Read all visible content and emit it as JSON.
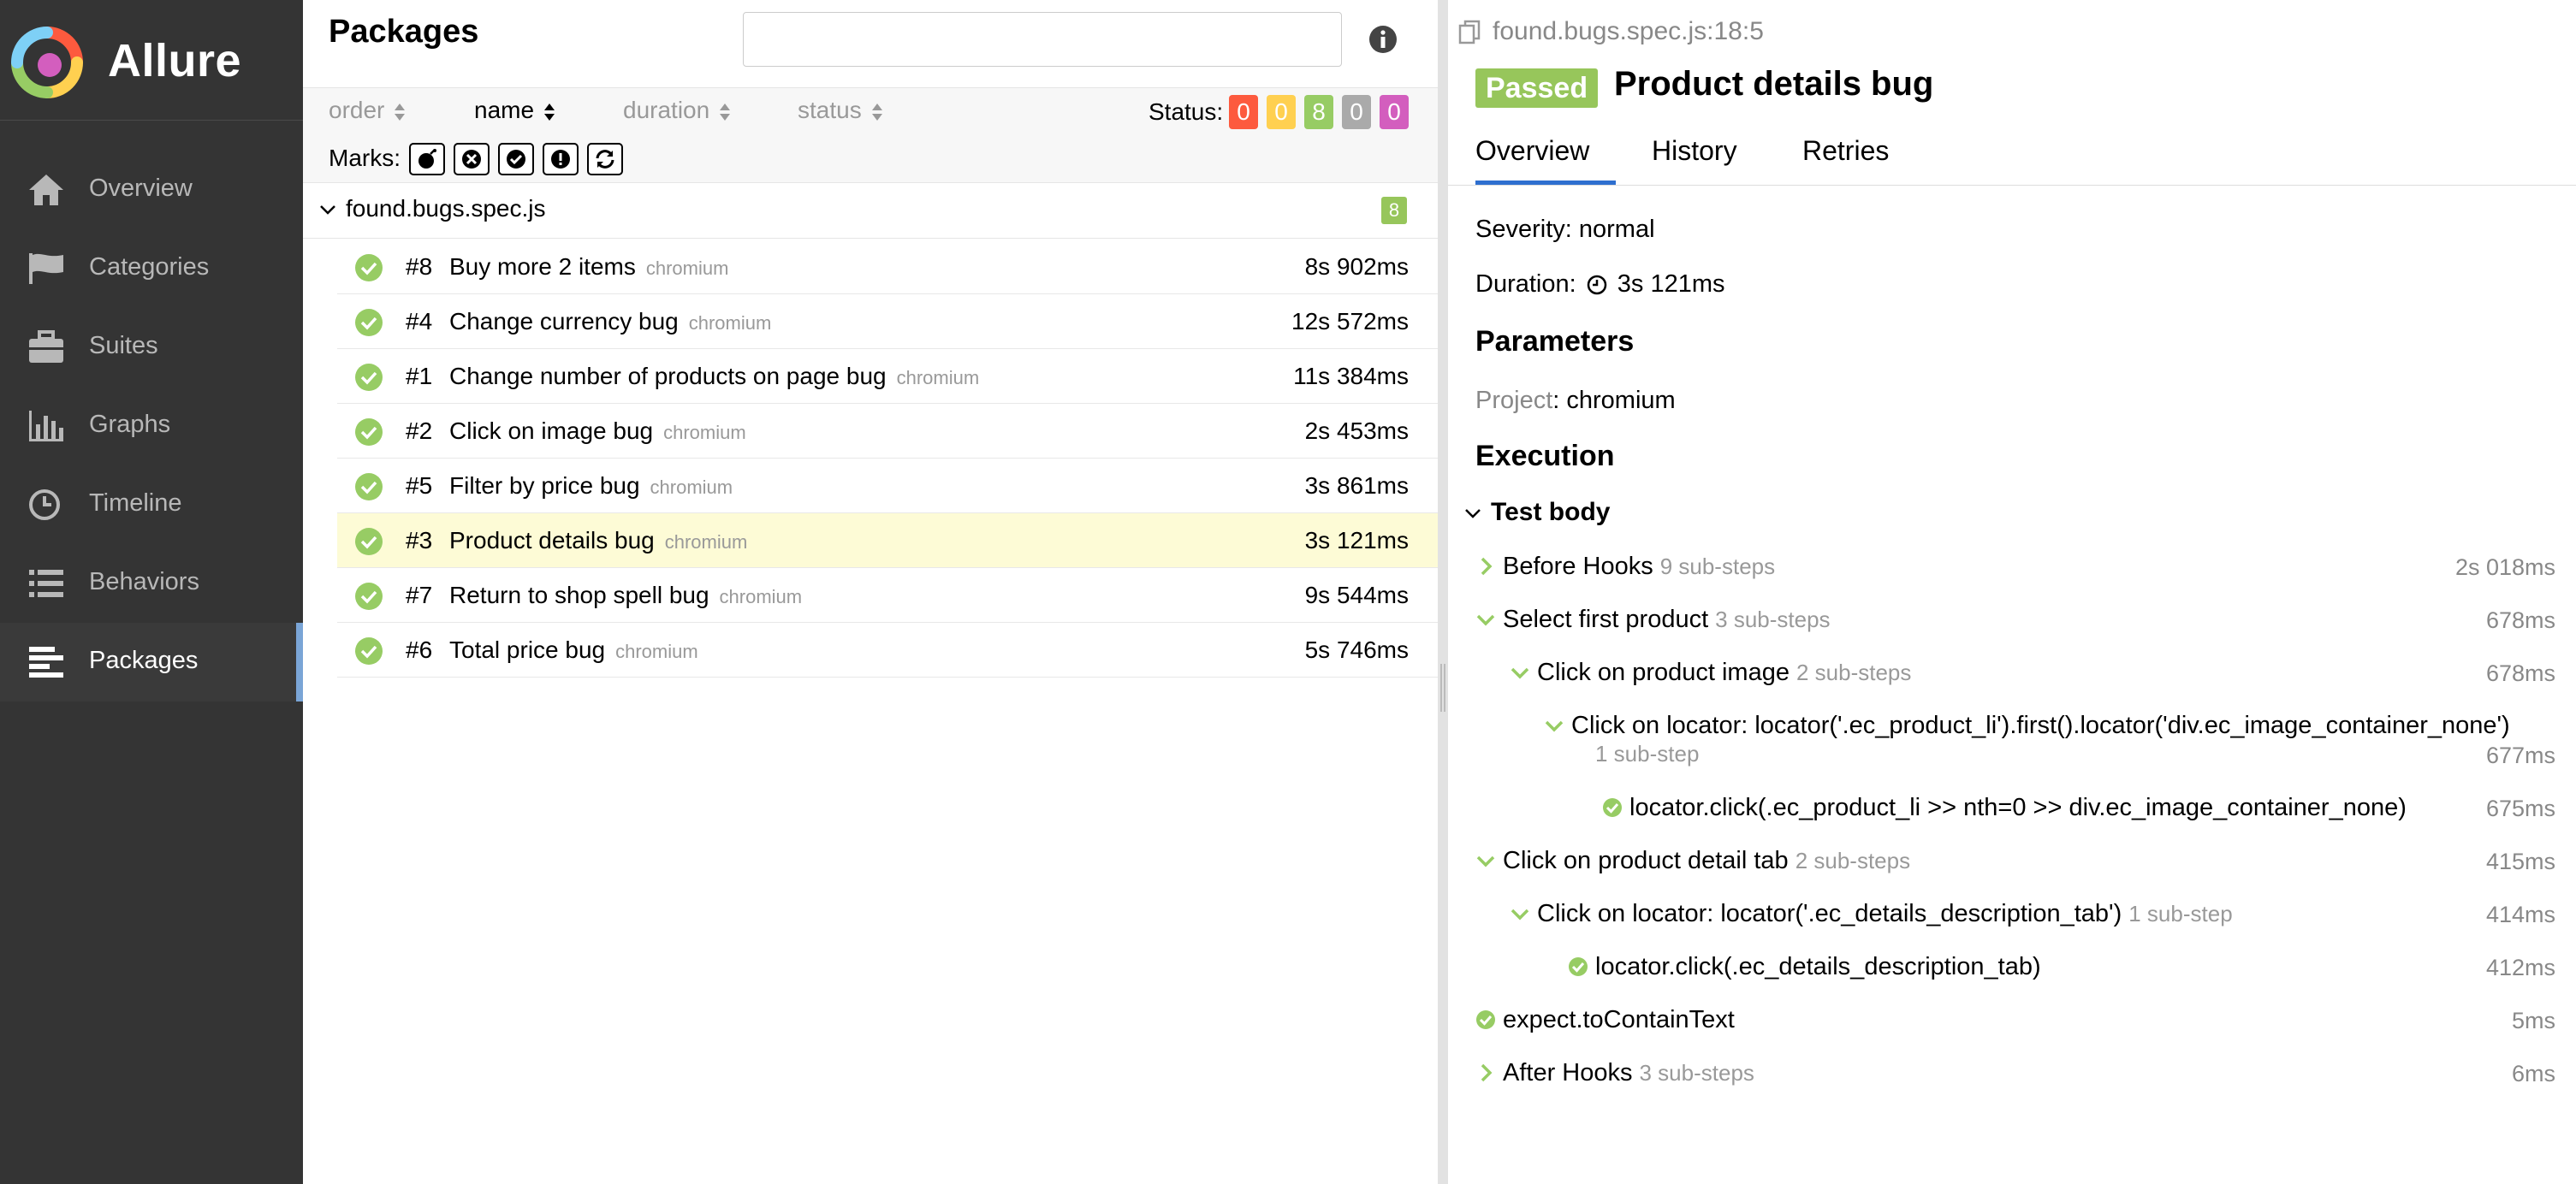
{
  "app": {
    "name": "Allure"
  },
  "sidebar": {
    "items": [
      {
        "label": "Overview",
        "icon": "home-icon"
      },
      {
        "label": "Categories",
        "icon": "flag-icon"
      },
      {
        "label": "Suites",
        "icon": "briefcase-icon"
      },
      {
        "label": "Graphs",
        "icon": "bar-chart-icon"
      },
      {
        "label": "Timeline",
        "icon": "clock-icon"
      },
      {
        "label": "Behaviors",
        "icon": "list-icon"
      },
      {
        "label": "Packages",
        "icon": "align-left-icon",
        "active": true
      }
    ]
  },
  "packages": {
    "title": "Packages",
    "filter_value": "",
    "sort": [
      {
        "label": "order"
      },
      {
        "label": "name",
        "active": true
      },
      {
        "label": "duration"
      },
      {
        "label": "status"
      }
    ],
    "status_label": "Status:",
    "status_counts": [
      {
        "value": "0",
        "color": "#fd5a3e",
        "status": "failed"
      },
      {
        "value": "0",
        "color": "#ffd050",
        "status": "broken"
      },
      {
        "value": "8",
        "color": "#97cc64",
        "status": "passed"
      },
      {
        "value": "0",
        "color": "#aaaaaa",
        "status": "skipped"
      },
      {
        "value": "0",
        "color": "#d35ebe",
        "status": "unknown"
      }
    ],
    "marks_label": "Marks:",
    "marks": [
      "flaky-icon",
      "new-failed-icon",
      "new-passed-icon",
      "new-broken-icon",
      "retries-icon"
    ],
    "group": {
      "name": "found.bugs.spec.js",
      "count": "8"
    },
    "tests": [
      {
        "num": "#8",
        "name": "Buy more 2 items",
        "project": "chromium",
        "duration": "8s 902ms"
      },
      {
        "num": "#4",
        "name": "Change currency bug",
        "project": "chromium",
        "duration": "12s 572ms"
      },
      {
        "num": "#1",
        "name": "Change number of products on page bug",
        "project": "chromium",
        "duration": "11s 384ms"
      },
      {
        "num": "#2",
        "name": "Click on image bug",
        "project": "chromium",
        "duration": "2s 453ms"
      },
      {
        "num": "#5",
        "name": "Filter by price bug",
        "project": "chromium",
        "duration": "3s 861ms"
      },
      {
        "num": "#3",
        "name": "Product details bug",
        "project": "chromium",
        "duration": "3s 121ms",
        "selected": true
      },
      {
        "num": "#7",
        "name": "Return to shop spell bug",
        "project": "chromium",
        "duration": "9s 544ms"
      },
      {
        "num": "#6",
        "name": "Total price bug",
        "project": "chromium",
        "duration": "5s 746ms"
      }
    ]
  },
  "detail": {
    "path": "found.bugs.spec.js:18:5",
    "status": "Passed",
    "title": "Product details bug",
    "tabs": [
      {
        "label": "Overview",
        "active": true
      },
      {
        "label": "History"
      },
      {
        "label": "Retries"
      }
    ],
    "severity": "Severity: normal",
    "duration_label": "Duration:",
    "duration_value": "3s 121ms",
    "parameters_heading": "Parameters",
    "param_key": "Project",
    "param_value": ": chromium",
    "execution_heading": "Execution",
    "test_body_label": "Test body",
    "steps": [
      {
        "label": "Before Hooks",
        "sub": "9 sub-steps",
        "duration": "2s 018ms",
        "expand": "collapsed"
      },
      {
        "label": "Select first product",
        "sub": "3 sub-steps",
        "duration": "678ms",
        "expand": "expanded"
      },
      {
        "label": "Click on product image",
        "sub": "2 sub-steps",
        "duration": "678ms",
        "expand": "expanded"
      },
      {
        "label": "Click on locator: locator('.ec_product_li').first().locator('div.ec_image_container_none')",
        "sub": "1 sub-step",
        "duration": "677ms",
        "expand": "expanded"
      },
      {
        "label": "locator.click(.ec_product_li >> nth=0 >> div.ec_image_container_none)",
        "sub": "",
        "duration": "675ms",
        "expand": "passed"
      },
      {
        "label": "Click on product detail tab",
        "sub": "2 sub-steps",
        "duration": "415ms",
        "expand": "expanded"
      },
      {
        "label": "Click on locator: locator('.ec_details_description_tab')",
        "sub": "1 sub-step",
        "duration": "414ms",
        "expand": "expanded"
      },
      {
        "label": "locator.click(.ec_details_description_tab)",
        "sub": "",
        "duration": "412ms",
        "expand": "passed"
      },
      {
        "label": "expect.toContainText",
        "sub": "",
        "duration": "5ms",
        "expand": "passed"
      },
      {
        "label": "After Hooks",
        "sub": "3 sub-steps",
        "duration": "6ms",
        "expand": "collapsed"
      }
    ]
  },
  "colors": {
    "sidebar_bg": "#343434",
    "passed": "#97cc64",
    "selected_row": "#fdfbd6",
    "tab_underline": "#2e6fcf"
  }
}
